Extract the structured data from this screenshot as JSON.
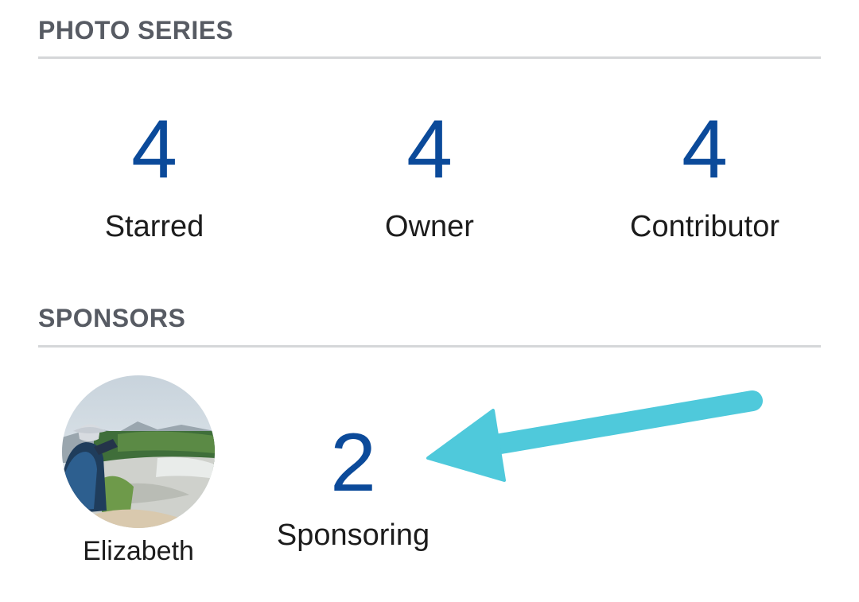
{
  "photo_series": {
    "title": "PHOTO SERIES",
    "stats": [
      {
        "count": "4",
        "label": "Starred"
      },
      {
        "count": "4",
        "label": "Owner"
      },
      {
        "count": "4",
        "label": "Contributor"
      }
    ]
  },
  "sponsors": {
    "title": "SPONSORS",
    "sponsor_name": "Elizabeth",
    "sponsoring_count": "2",
    "sponsoring_label": "Sponsoring"
  },
  "colors": {
    "count_blue": "#0b4a9a",
    "section_title_gray": "#575b63",
    "divider_gray": "#d5d7d9",
    "arrow_cyan": "#4fc9db"
  },
  "icons": {
    "annotation": "arrow-icon",
    "avatar": "user-photo-avatar"
  }
}
